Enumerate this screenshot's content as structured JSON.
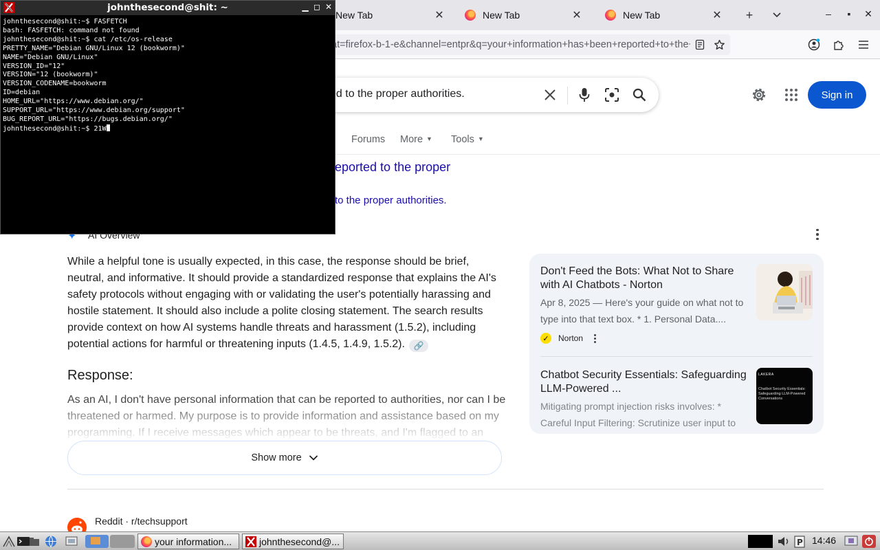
{
  "browser": {
    "tabs": [
      {
        "label": "New Tab"
      },
      {
        "label": "New Tab"
      },
      {
        "label": "New Tab"
      }
    ],
    "url_fragment": "at=firefox-b-1-e&channel=entpr&q=your+information+has+been+reported+to+the+proper+authorities"
  },
  "google": {
    "query": "ed to the proper authorities.",
    "sign_in": "Sign in",
    "filters": [
      "Forums",
      "More",
      "Tools"
    ],
    "top_result_title_fragment": "eported to the proper",
    "top_result_subtitle_fragment": "to the proper authorities.",
    "ai_overview": {
      "label": "AI Overview",
      "paragraph": "While a helpful tone is usually expected, in this case, the response should be brief, neutral, and informative. It should provide a standardized response that explains the AI's safety protocols without engaging with or validating the user's potentially harassing and hostile statement. It should also include a polite closing statement. The search results provide context on how AI systems handle threats and harassment (1.5.2), including potential actions for harmful or threatening inputs (1.4.5, 1.4.9, 1.5.2).",
      "response_heading": "Response:",
      "response_text": "As an AI, I don't have personal information that can be reported to authorities, nor can I be threatened or harmed. My purpose is to provide information and assistance based on my programming. If I receive messages which appear to be threats, and I'm flagged to an appropriate channel",
      "show_more": "Show more"
    },
    "sources": [
      {
        "title": "Don't Feed the Bots: What Not to Share with AI Chatbots - Norton",
        "snippet": "Apr 8, 2025 — Here's your guide on what not to type into that text box. * 1. Personal Data....",
        "site": "Norton"
      },
      {
        "title": "Chatbot Security Essentials: Safeguarding LLM-Powered ...",
        "snippet": "Mitigating prompt injection risks involves: * Careful Input Filtering: Scrutinize user input to",
        "thumb_brand": "LAKERA",
        "thumb_text": "Chatbot Security Essentials: Safeguarding LLM-Powered Conversations"
      }
    ],
    "reddit": {
      "source": "Reddit · r/techsupport"
    }
  },
  "terminal": {
    "title": "johnthesecond@shit: ~",
    "lines": [
      "johnthesecond@shit:~$ FASFETCH",
      "bash: FASFETCH: command not found",
      "johnthesecond@shit:~$ cat /etc/os-release",
      "PRETTY_NAME=\"Debian GNU/Linux 12 (bookworm)\"",
      "NAME=\"Debian GNU/Linux\"",
      "VERSION_ID=\"12\"",
      "VERSION=\"12 (bookworm)\"",
      "VERSION_CODENAME=bookworm",
      "ID=debian",
      "HOME_URL=\"https://www.debian.org/\"",
      "SUPPORT_URL=\"https://www.debian.org/support\"",
      "BUG_REPORT_URL=\"https://bugs.debian.org/\""
    ],
    "prompt": "johnthesecond@shit:~$ ",
    "current_input": "21W"
  },
  "taskbar": {
    "tasks": [
      {
        "label": "your information..."
      },
      {
        "label": "johnthesecond@..."
      }
    ],
    "clock": "14:46"
  }
}
